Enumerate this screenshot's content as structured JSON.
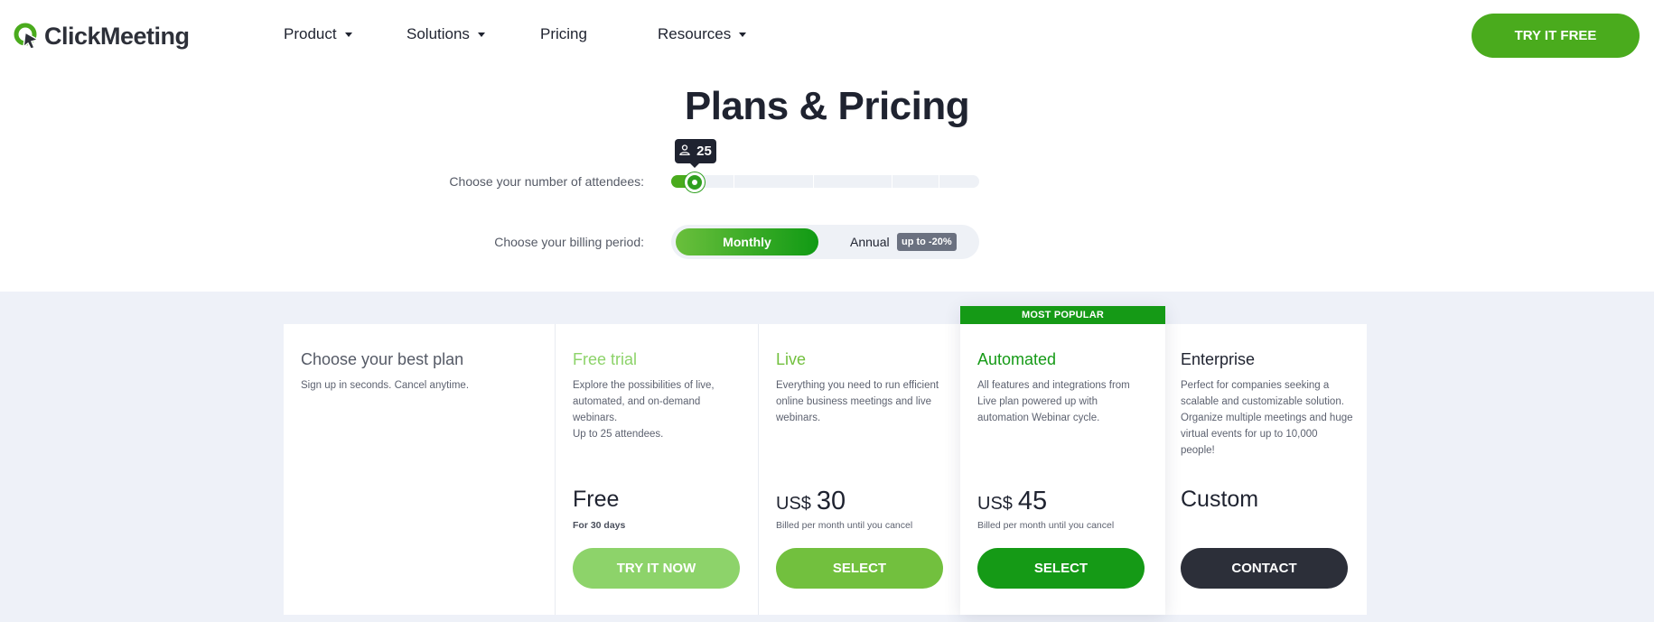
{
  "header": {
    "logo_text": "ClickMeeting",
    "nav": [
      {
        "label": "Product",
        "dropdown": true
      },
      {
        "label": "Solutions",
        "dropdown": true
      },
      {
        "label": "Pricing",
        "dropdown": false
      },
      {
        "label": "Resources",
        "dropdown": true
      }
    ],
    "cta_label": "TRY IT FREE"
  },
  "page_title": "Plans & Pricing",
  "attendees": {
    "label": "Choose your number of attendees:",
    "value": "25",
    "slider_fraction": 0.05
  },
  "billing": {
    "label": "Choose your billing period:",
    "monthly_label": "Monthly",
    "annual_label": "Annual",
    "discount_badge": "up to -20%",
    "selected": "Monthly"
  },
  "plans_intro": {
    "title": "Choose your best plan",
    "subtitle": "Sign up in seconds. Cancel anytime."
  },
  "plans": [
    {
      "name": "Free trial",
      "description": "Explore the possibilities of live, automated, and on-demand webinars.",
      "description_extra": "Up to 25 attendees.",
      "price_text": "Free",
      "note": "For 30 days",
      "button": "TRY IT NOW",
      "accent": "#8dd36a"
    },
    {
      "name": "Live",
      "description": "Everything you need to run efficient online business meetings and live webinars.",
      "currency": "US$",
      "amount": "30",
      "note": "Billed per month until you cancel",
      "button": "SELECT",
      "accent": "#72c03e"
    },
    {
      "name": "Automated",
      "badge": "MOST POPULAR",
      "description": "All features and integrations from Live plan powered up with automation Webinar cycle.",
      "currency": "US$",
      "amount": "45",
      "note": "Billed per month until you cancel",
      "button": "SELECT",
      "accent": "#159a16"
    },
    {
      "name": "Enterprise",
      "description": "Perfect for companies seeking a scalable and customizable solution. Organize multiple meetings and huge virtual events for up to 10,000 people!",
      "price_text": "Custom",
      "button": "CONTACT",
      "accent": "#2c2f39"
    }
  ],
  "colors": {
    "brand_green": "#4aab1d",
    "dark": "#1f2330",
    "section_bg": "#eef1f8"
  }
}
